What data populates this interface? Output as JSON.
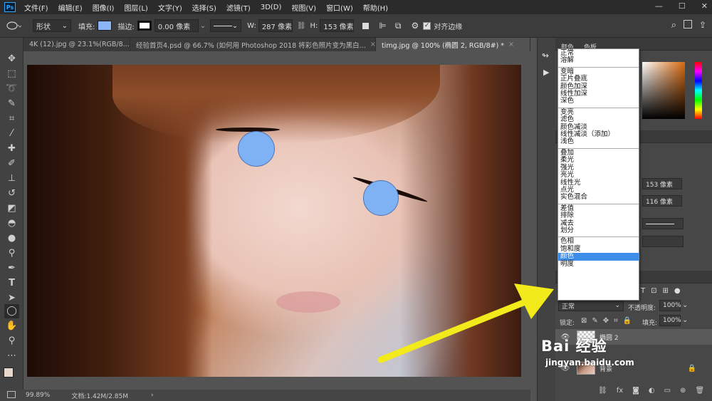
{
  "menubar": {
    "logo": "Ps",
    "items": [
      "文件(F)",
      "编辑(E)",
      "图像(I)",
      "图层(L)",
      "文字(Y)",
      "选择(S)",
      "滤镜(T)",
      "3D(D)",
      "视图(V)",
      "窗口(W)",
      "帮助(H)"
    ],
    "win_min": "—",
    "win_max": "☐",
    "win_close": "✕"
  },
  "options": {
    "mode": "形状",
    "fill_label": "填充:",
    "fill_color": "#8ab6f8",
    "stroke_label": "描边:",
    "stroke_width": "0.00 像素",
    "w_label": "W:",
    "w_value": "287 像素",
    "h_label": "H:",
    "h_value": "153 像素",
    "align_edges": "对齐边缘"
  },
  "tabs": [
    {
      "label": "4K (12).jpg @ 23.1%(RGB/8...",
      "active": false
    },
    {
      "label": "经验首页4.psd @ 66.7% (如何用  Photoshop 2018  将彩色照片变为黑白...",
      "active": false
    },
    {
      "label": "timg.jpg @ 100% (椭圆 2, RGB/8#) *",
      "active": true
    }
  ],
  "status": {
    "zoom": "99.89%",
    "doc": "文档:1.42M/2.85M",
    "arrow": "›"
  },
  "panel": {
    "tab_color": "颜色",
    "tab_swatch": "色板",
    "w_field": "153 像素",
    "h_field": "116 像素",
    "blend_mode": "正常",
    "opacity_label": "不透明度:",
    "opacity_value": "100%",
    "lock_label": "锁定:",
    "fill_label": "填充:",
    "fill_value": "100%",
    "fx": "fx"
  },
  "blend_groups": [
    [
      "正常",
      "溶解"
    ],
    [
      "变暗",
      "正片叠底",
      "颜色加深",
      "线性加深",
      "深色"
    ],
    [
      "变亮",
      "滤色",
      "颜色减淡",
      "线性减淡（添加）",
      "浅色"
    ],
    [
      "叠加",
      "柔光",
      "强光",
      "亮光",
      "线性光",
      "点光",
      "实色混合"
    ],
    [
      "差值",
      "排除",
      "减去",
      "划分"
    ],
    [
      "色相",
      "饱和度",
      "颜色",
      "明度"
    ]
  ],
  "blend_selected": "颜色",
  "layers": [
    {
      "name": "椭圆 2"
    },
    {
      "name": "背景"
    }
  ],
  "watermark": {
    "brand": "Bai 经验",
    "url": "jingyan.baidu.com"
  }
}
